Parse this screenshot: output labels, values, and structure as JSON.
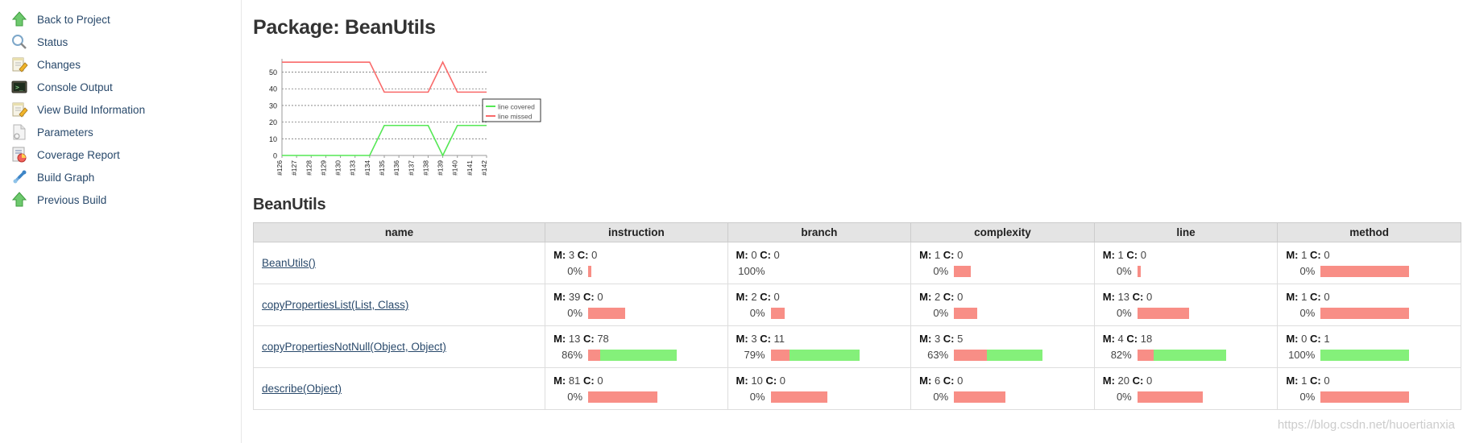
{
  "sidebar": {
    "items": [
      {
        "label": "Back to Project",
        "icon": "up-arrow-icon"
      },
      {
        "label": "Status",
        "icon": "magnifier-icon"
      },
      {
        "label": "Changes",
        "icon": "notepad-pencil-icon"
      },
      {
        "label": "Console Output",
        "icon": "terminal-icon"
      },
      {
        "label": "View Build Information",
        "icon": "notepad-pencil-icon"
      },
      {
        "label": "Parameters",
        "icon": "document-icon"
      },
      {
        "label": "Coverage Report",
        "icon": "pie-chart-icon"
      },
      {
        "label": "Build Graph",
        "icon": "chain-link-icon"
      },
      {
        "label": "Previous Build",
        "icon": "up-arrow-icon"
      }
    ]
  },
  "main": {
    "page_title": "Package: BeanUtils",
    "section_title": "BeanUtils",
    "watermark": "https://blog.csdn.net/huoertianxia"
  },
  "chart_data": {
    "type": "line",
    "title": "",
    "xlabel": "",
    "ylabel": "",
    "x": [
      "#126",
      "#127",
      "#128",
      "#129",
      "#130",
      "#133",
      "#134",
      "#135",
      "#136",
      "#137",
      "#138",
      "#139",
      "#140",
      "#141",
      "#142"
    ],
    "yticks": [
      0,
      10,
      20,
      30,
      40,
      50
    ],
    "ylim": [
      0,
      58
    ],
    "grid": true,
    "legend_position": "right",
    "series": [
      {
        "name": "line covered",
        "color": "#55e855",
        "values": [
          0,
          0,
          0,
          0,
          0,
          0,
          0,
          18,
          18,
          18,
          18,
          0,
          18,
          18,
          18
        ]
      },
      {
        "name": "line missed",
        "color": "#f96a6a",
        "values": [
          56,
          56,
          56,
          56,
          56,
          56,
          56,
          38,
          38,
          38,
          38,
          56,
          38,
          38,
          38
        ]
      }
    ]
  },
  "table": {
    "columns": [
      "name",
      "instruction",
      "branch",
      "complexity",
      "line",
      "method"
    ],
    "rows": [
      {
        "name": "BeanUtils()",
        "instruction": {
          "missed": "3",
          "covered": "0",
          "pct": "0%",
          "missed_w": 4,
          "covered_w": 0
        },
        "branch": {
          "missed": "0",
          "covered": "0",
          "pct": "100%",
          "missed_w": 0,
          "covered_w": 0
        },
        "complexity": {
          "missed": "1",
          "covered": "0",
          "pct": "0%",
          "missed_w": 19,
          "covered_w": 0
        },
        "line": {
          "missed": "1",
          "covered": "0",
          "pct": "0%",
          "missed_w": 4,
          "covered_w": 0
        },
        "method": {
          "missed": "1",
          "covered": "0",
          "pct": "0%",
          "missed_w": 100,
          "covered_w": 0
        }
      },
      {
        "name": "copyPropertiesList(List, Class)",
        "instruction": {
          "missed": "39",
          "covered": "0",
          "pct": "0%",
          "missed_w": 42,
          "covered_w": 0
        },
        "branch": {
          "missed": "2",
          "covered": "0",
          "pct": "0%",
          "missed_w": 16,
          "covered_w": 0
        },
        "complexity": {
          "missed": "2",
          "covered": "0",
          "pct": "0%",
          "missed_w": 26,
          "covered_w": 0
        },
        "line": {
          "missed": "13",
          "covered": "0",
          "pct": "0%",
          "missed_w": 58,
          "covered_w": 0
        },
        "method": {
          "missed": "1",
          "covered": "0",
          "pct": "0%",
          "missed_w": 100,
          "covered_w": 0
        }
      },
      {
        "name": "copyPropertiesNotNull(Object, Object)",
        "instruction": {
          "missed": "13",
          "covered": "78",
          "pct": "86%",
          "missed_w": 14,
          "covered_w": 86
        },
        "branch": {
          "missed": "3",
          "covered": "11",
          "pct": "79%",
          "missed_w": 21,
          "covered_w": 79
        },
        "complexity": {
          "missed": "3",
          "covered": "5",
          "pct": "63%",
          "missed_w": 37,
          "covered_w": 63
        },
        "line": {
          "missed": "4",
          "covered": "18",
          "pct": "82%",
          "missed_w": 18,
          "covered_w": 82
        },
        "method": {
          "missed": "0",
          "covered": "1",
          "pct": "100%",
          "missed_w": 0,
          "covered_w": 100
        }
      },
      {
        "name": "describe(Object)",
        "instruction": {
          "missed": "81",
          "covered": "0",
          "pct": "0%",
          "missed_w": 78,
          "covered_w": 0
        },
        "branch": {
          "missed": "10",
          "covered": "0",
          "pct": "0%",
          "missed_w": 64,
          "covered_w": 0
        },
        "complexity": {
          "missed": "6",
          "covered": "0",
          "pct": "0%",
          "missed_w": 58,
          "covered_w": 0
        },
        "line": {
          "missed": "20",
          "covered": "0",
          "pct": "0%",
          "missed_w": 74,
          "covered_w": 0
        },
        "method": {
          "missed": "1",
          "covered": "0",
          "pct": "0%",
          "missed_w": 100,
          "covered_w": 0
        }
      }
    ]
  }
}
